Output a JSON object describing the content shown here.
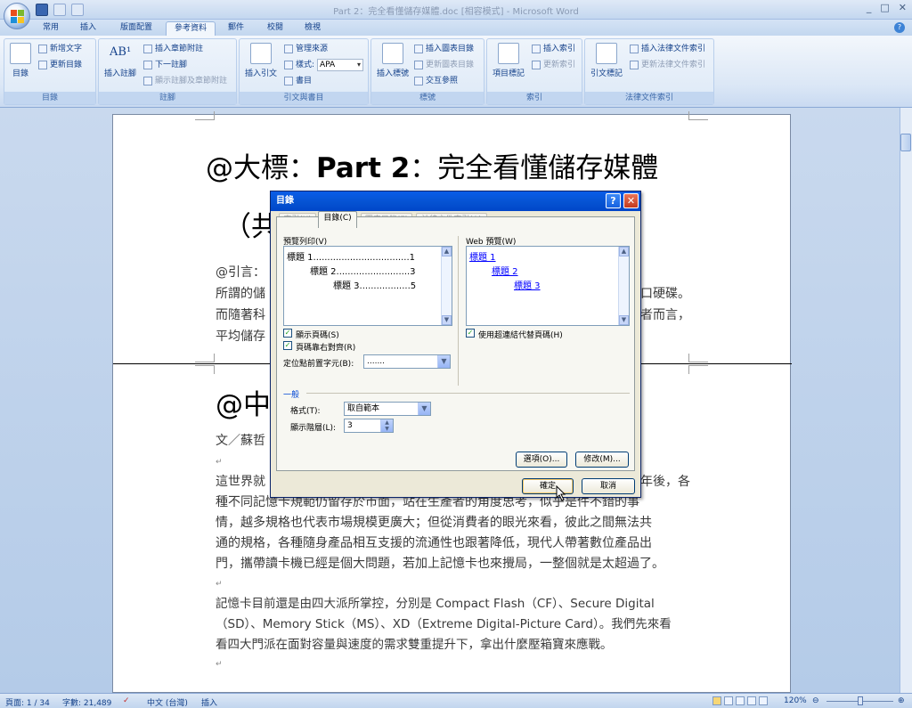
{
  "window": {
    "title": "Part 2：完全看懂儲存媒體.doc [相容模式] - Microsoft Word",
    "controls": [
      "_",
      "□",
      "✕"
    ]
  },
  "tabs": [
    {
      "label": "常用"
    },
    {
      "label": "插入"
    },
    {
      "label": "版面配置"
    },
    {
      "label": "參考資料",
      "active": true
    },
    {
      "label": "郵件"
    },
    {
      "label": "校閱"
    },
    {
      "label": "檢視"
    }
  ],
  "ribbon": {
    "toc_group": {
      "label": "目錄",
      "toc_button": "目錄",
      "add_text": "新增文字",
      "update_toc": "更新目錄"
    },
    "footnote_group": {
      "label": "註腳",
      "insert_footnote": "插入註腳",
      "insert_endnote": "插入章節附註",
      "next_footnote": "下一註腳",
      "show_notes": "顯示註腳及章節附註"
    },
    "citation_group": {
      "label": "引文與書目",
      "insert_citation": "插入引文",
      "manage_sources": "管理來源",
      "style_label": "樣式:",
      "style_value": "APA",
      "bibliography": "書目"
    },
    "caption_group": {
      "label": "標號",
      "insert_caption": "插入標號",
      "insert_table_of_figures": "插入圖表目錄",
      "update_table": "更新圖表目錄",
      "cross_reference": "交互參照"
    },
    "index_group": {
      "label": "索引",
      "mark_entry": "項目標記",
      "insert_index": "插入索引",
      "update_index": "更新索引"
    },
    "authorities_group": {
      "label": "法律文件索引",
      "mark_citation": "引文標記",
      "insert_toa": "插入法律文件索引",
      "update_toa": "更新法律文件索引"
    }
  },
  "document": {
    "heading1_prefix": "@大標：",
    "heading1_bold": "Part 2",
    "heading1_suffix": "：完全看懂儲存媒體",
    "heading1_line2": "（共",
    "intro_label": "@引言：",
    "intro_line1": "所謂的儲",
    "intro_line1_end": "口硬碟。",
    "intro_line2": "而隨著科",
    "intro_line2_end": "者而言，",
    "intro_line3": "平均儲存",
    "heading2": "@中",
    "byline": "文／蘇哲",
    "para1_line1a": "這世界就",
    "para1_line1b": "年後，各",
    "para1_line2": "種不同記憶卡規範仍留存於市面，站在生產者的角度思考，似乎是件不錯的事",
    "para1_line3": "情，越多規格也代表市場規模更廣大；但從消費者的眼光來看，彼此之間無法共",
    "para1_line4": "通的規格，各種隨身產品相互支援的流通性也跟著降低，現代人帶著數位產品出",
    "para1_line5": "門，攜帶讀卡機已經是個大問題，若加上記憶卡也來攪局，一整個就是太超過了。",
    "para2_line1": "記憶卡目前還是由四大派所掌控，分別是 Compact Flash（CF）、Secure Digital",
    "para2_line2": "（SD）、Memory Stick（MS）、XD（Extreme Digital-Picture Card）。我們先來看",
    "para2_line3": "看四大門派在面對容量與速度的需求雙重提升下，拿出什麼壓箱寶來應戰。",
    "para_mark": "↵"
  },
  "dialog": {
    "title": "目錄",
    "help": "?",
    "close": "✕",
    "tabs": [
      "索引(X)",
      "目錄(C)",
      "圖表目錄(F)",
      "法律文件索引(A)"
    ],
    "print_preview_label": "預覽列印(V)",
    "web_preview_label": "Web 預覽(W)",
    "print_entries": [
      {
        "text": "標題 1..................................1"
      },
      {
        "text": "標題 2..........................3"
      },
      {
        "text": "標題 3..................5"
      }
    ],
    "web_entries": [
      "標題 1",
      "標題 2",
      "標題 3"
    ],
    "show_page_numbers": "顯示頁碼(S)",
    "right_align": "頁碼靠右對齊(R)",
    "tab_leader_label": "定位點前置字元(B):",
    "tab_leader_value": ".......",
    "use_hyperlinks": "使用超連結代替頁碼(H)",
    "general_label": "一般",
    "format_label": "格式(T):",
    "format_value": "取自範本",
    "levels_label": "顯示階層(L):",
    "levels_value": "3",
    "options_button": "選項(O)...",
    "modify_button": "修改(M)...",
    "ok_button": "確定",
    "cancel_button": "取消"
  },
  "status": {
    "page": "頁面: 1 / 34",
    "words": "字數: 21,489",
    "language": "中文 (台灣)",
    "mode": "插入",
    "zoom": "120%"
  }
}
